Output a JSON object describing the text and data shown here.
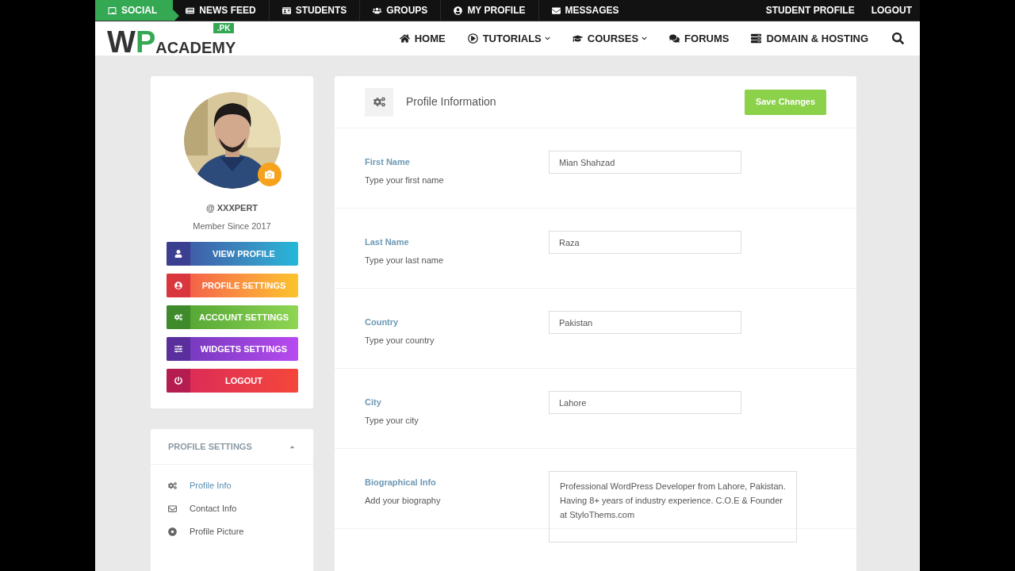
{
  "top_bar": {
    "items": [
      {
        "label": "SOCIAL",
        "selected": true
      },
      {
        "label": "NEWS FEED",
        "selected": false
      },
      {
        "label": "STUDENTS",
        "selected": false
      },
      {
        "label": "GROUPS",
        "selected": false
      },
      {
        "label": "MY PROFILE",
        "selected": false
      },
      {
        "label": "MESSAGES",
        "selected": false
      }
    ],
    "right_links": [
      "STUDENT PROFILE",
      "LOGOUT"
    ]
  },
  "header": {
    "logo": {
      "main": "WP",
      "rest": "ACADEMY",
      "tag": ".PK"
    },
    "nav": [
      {
        "label": "HOME",
        "has_dropdown": false
      },
      {
        "label": "TUTORIALS",
        "has_dropdown": true
      },
      {
        "label": "COURSES",
        "has_dropdown": true
      },
      {
        "label": "FORUMS",
        "has_dropdown": false
      },
      {
        "label": "DOMAIN & HOSTING",
        "has_dropdown": false
      }
    ]
  },
  "profile_card": {
    "username": "@ XXXPERT",
    "member_since": "Member Since 2017",
    "buttons": [
      {
        "label": "VIEW PROFILE",
        "color": "#3b3f8f"
      },
      {
        "label": "PROFILE SETTINGS",
        "color": "#d9363e"
      },
      {
        "label": "ACCOUNT SETTINGS",
        "color": "#3f8a2a"
      },
      {
        "label": "WIDGETS SETTINGS",
        "color": "#5a2e9c"
      },
      {
        "label": "LOGOUT",
        "color": "#b51d50"
      }
    ]
  },
  "settings_menu": {
    "title": "PROFILE SETTINGS",
    "expanded": true,
    "items": [
      {
        "label": "Profile Info",
        "selected": true
      },
      {
        "label": "Contact Info",
        "selected": false
      },
      {
        "label": "Profile Picture",
        "selected": false
      }
    ]
  },
  "form": {
    "title": "Profile Information",
    "save_button": "Save Changes",
    "fields": [
      {
        "kind": "text",
        "label": "First Name",
        "hint": "Type your first name",
        "value": "Mian Shahzad"
      },
      {
        "kind": "text",
        "label": "Last Name",
        "hint": "Type your last name",
        "value": "Raza"
      },
      {
        "kind": "text",
        "label": "Country",
        "hint": "Type your country",
        "value": "Pakistan"
      },
      {
        "kind": "text",
        "label": "City",
        "hint": "Type your city",
        "value": "Lahore"
      },
      {
        "kind": "textarea",
        "label": "Biographical Info",
        "hint": "Add your biography",
        "value": "Professional WordPress Developer from Lahore, Pakistan. Having 8+ years of industry experience. C.O.E & Founder at StyloThems.com"
      }
    ]
  }
}
